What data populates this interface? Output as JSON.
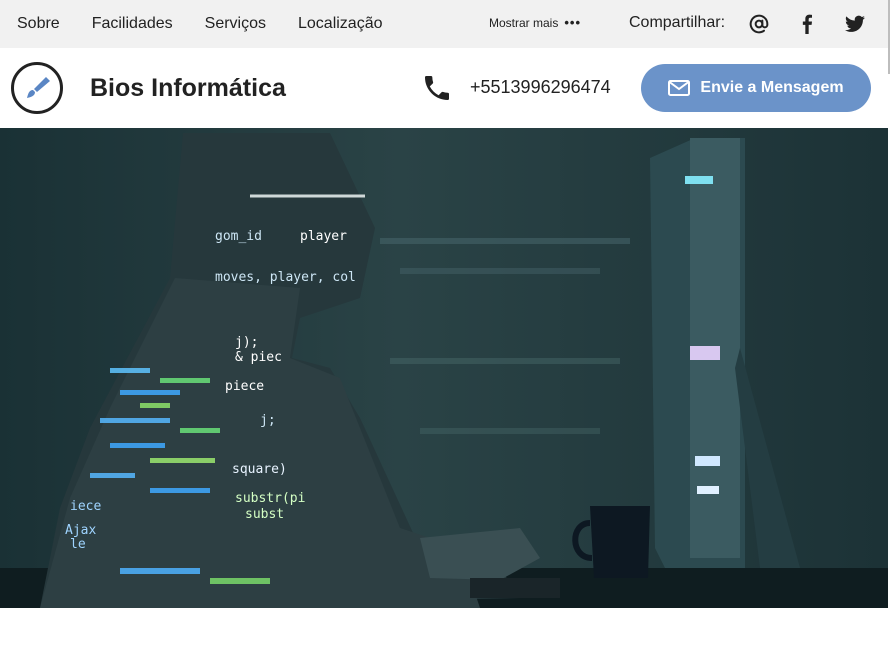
{
  "topbar": {
    "nav": [
      "Sobre",
      "Facilidades",
      "Serviços",
      "Localização"
    ],
    "more_label": "Mostrar mais",
    "share_label": "Compartilhar:",
    "social_icons": [
      "at-icon",
      "facebook-icon",
      "twitter-icon"
    ]
  },
  "header": {
    "brand": "Bios Informática",
    "phone": "+5513996296474",
    "message_button": "Envie a Mensagem"
  },
  "hero": {
    "code_lines": [
      "gom_id",
      "player",
      "moves, player, col",
      "j);",
      "& piec",
      "piece",
      "j;",
      "square)",
      "substr(pi",
      "subst",
      "iece",
      "Ajax",
      "le"
    ]
  },
  "colors": {
    "accent": "#6b93c9",
    "topbar_bg": "#f1f1f1",
    "text": "#222222"
  }
}
